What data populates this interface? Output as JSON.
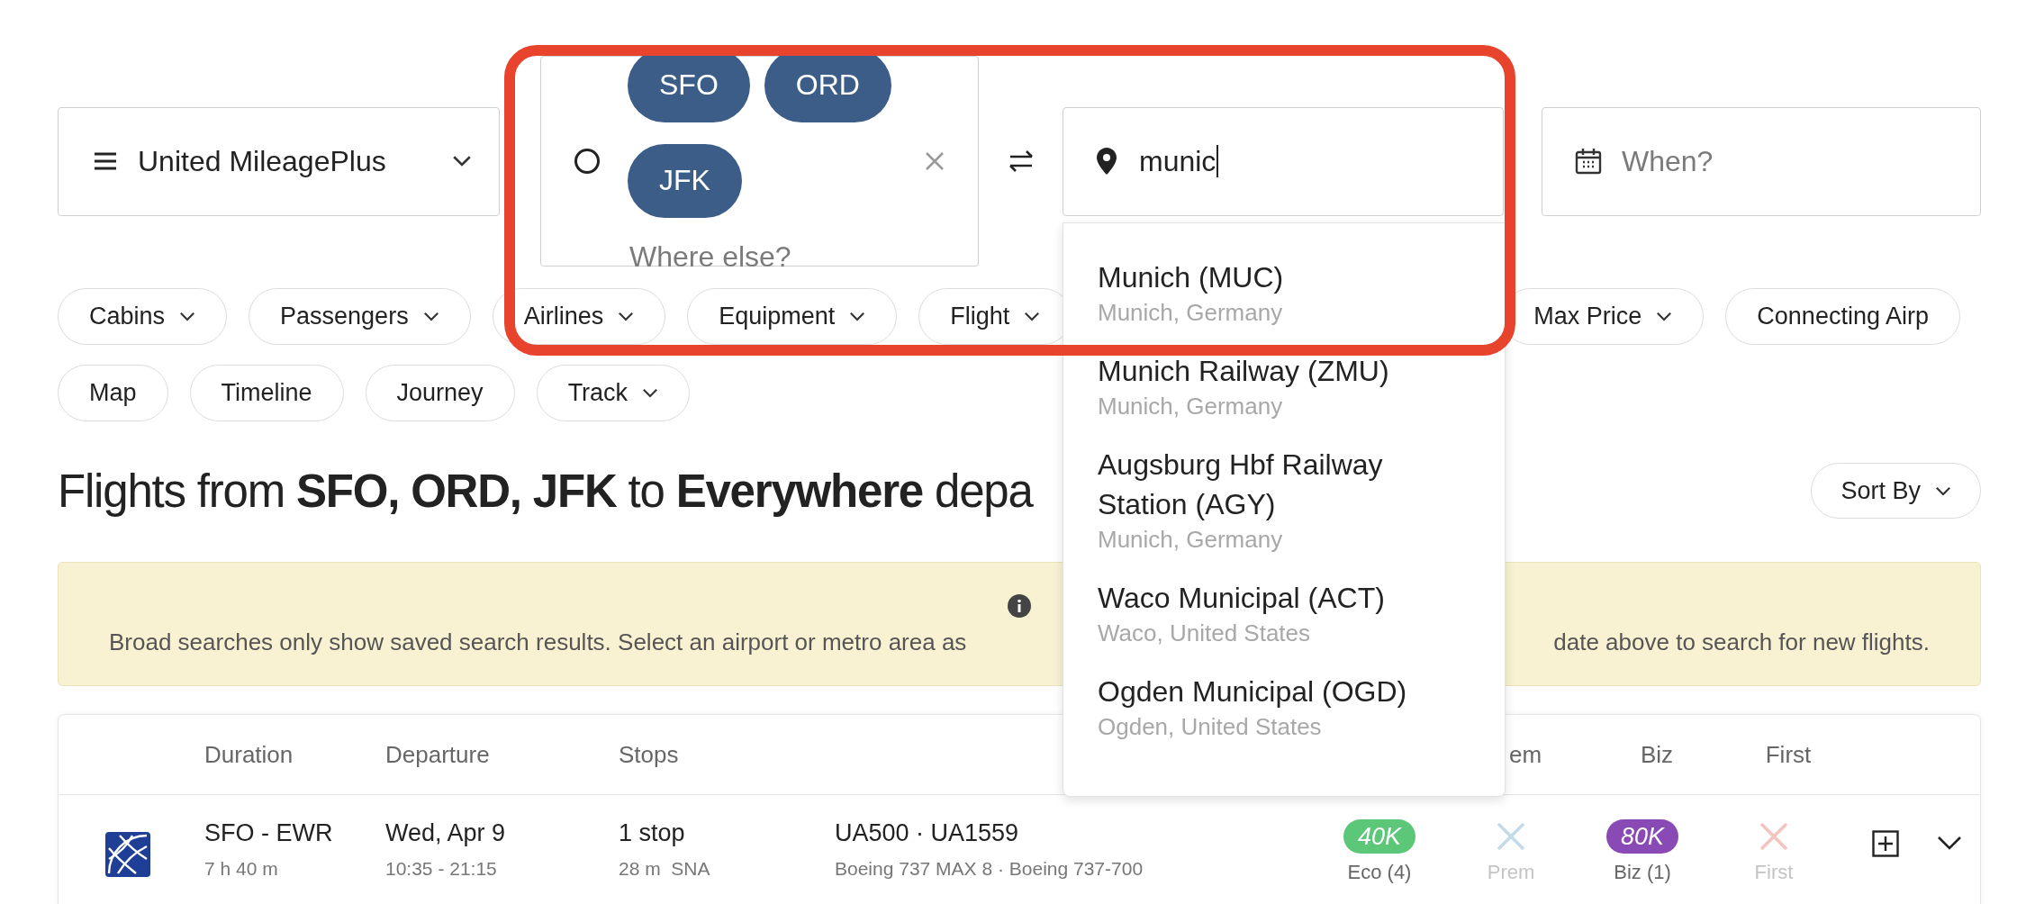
{
  "program_select": {
    "label": "United MileagePlus"
  },
  "origin": {
    "airports": [
      "SFO",
      "ORD",
      "JFK"
    ],
    "placeholder": "Where else?"
  },
  "destination": {
    "value": "munic"
  },
  "date": {
    "placeholder": "When?"
  },
  "filters": [
    {
      "label": "Cabins",
      "has_menu": true
    },
    {
      "label": "Passengers",
      "has_menu": true
    },
    {
      "label": "Airlines",
      "has_menu": true
    },
    {
      "label": "Equipment",
      "has_menu": true
    },
    {
      "label": "Flight",
      "has_menu": true
    },
    {
      "label": "Max Price",
      "has_menu": true
    },
    {
      "label": "Connecting Airp",
      "has_menu": false
    }
  ],
  "views": [
    {
      "label": "Map",
      "has_menu": false
    },
    {
      "label": "Timeline",
      "has_menu": false
    },
    {
      "label": "Journey",
      "has_menu": false
    },
    {
      "label": "Track",
      "has_menu": true
    }
  ],
  "heading": "Flights from **SFO, ORD, JFK** to **Everywhere** depa",
  "sort": {
    "label": "Sort By"
  },
  "notice": {
    "text_left": "Broad searches only show saved search results. Select an airport or metro area as",
    "text_right": "date above to search for new flights."
  },
  "table": {
    "columns": [
      {},
      {
        "label": "Duration"
      },
      {
        "label": "Departure"
      },
      {
        "label": "Stops"
      },
      {},
      {},
      {
        "label": "em"
      },
      {
        "label": "Biz"
      },
      {
        "label": "First"
      }
    ],
    "rows": [
      {
        "cells": [
          {
            "kind": "logo"
          },
          {
            "kind": "text",
            "main": "SFO - EWR",
            "sub": "7 h 40 m"
          },
          {
            "kind": "text",
            "main": "Wed, Apr 9",
            "sub": "10:35 - 21:15"
          },
          {
            "kind": "text",
            "main": "1 stop",
            "sub": "28 m  SNA"
          },
          {
            "kind": "text",
            "main": "UA500 · UA1559",
            "sub": "Boeing 737 MAX 8 · Boeing 737-700"
          },
          {
            "kind": "award",
            "points": "40K",
            "cabin": "Eco (4)",
            "color": "#5cc679"
          },
          {
            "kind": "unavailable",
            "cabin": "Prem",
            "color": "#c3dbe8"
          },
          {
            "kind": "award",
            "points": "80K",
            "cabin": "Biz (1)",
            "color": "#8a4ab5"
          },
          {
            "kind": "unavailable",
            "cabin": "First",
            "color": "#f2c5bf"
          }
        ]
      }
    ]
  },
  "suggestions": [
    {
      "name": "Munich (MUC)",
      "location": "Munich, Germany"
    },
    {
      "name": "Munich Railway (ZMU)",
      "location": "Munich, Germany"
    },
    {
      "name": "Augsburg Hbf Railway Station (AGY)",
      "location": "Munich, Germany"
    },
    {
      "name": "Waco Municipal (ACT)",
      "location": "Waco, United States"
    },
    {
      "name": "Ogden Municipal (OGD)",
      "location": "Ogden, United States"
    }
  ]
}
